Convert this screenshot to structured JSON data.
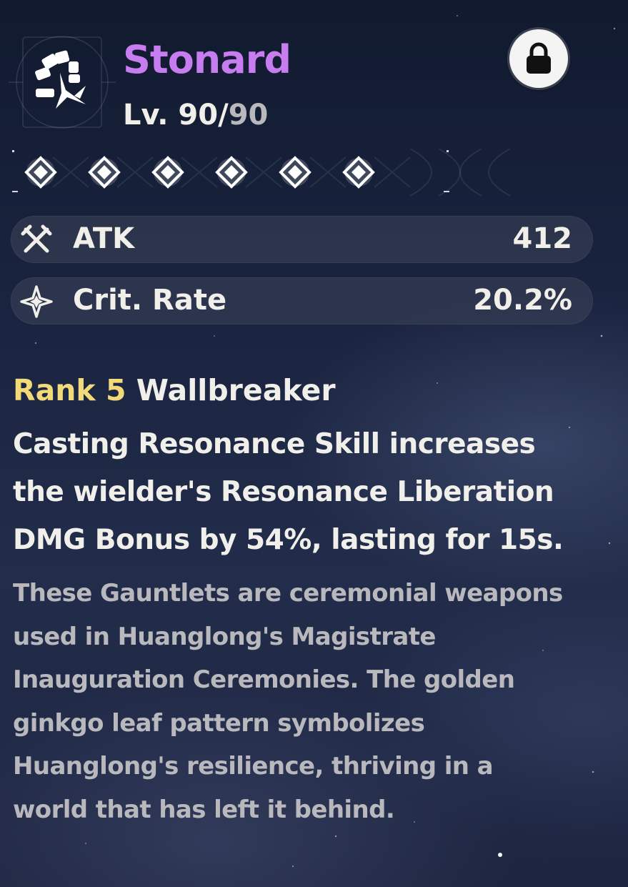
{
  "weapon": {
    "name": "Stonard",
    "level_prefix": "Lv. 90/",
    "level_max": "90",
    "icon": "gauntlet-fist-icon",
    "locked": true,
    "lock_icon": "padlock-icon"
  },
  "rank": {
    "total": 6,
    "filled": 6,
    "icon": "diamond-icon"
  },
  "stats": [
    {
      "icon": "crossed-swords-icon",
      "label": "ATK",
      "value": "412"
    },
    {
      "icon": "four-point-star-icon",
      "label": "Crit. Rate",
      "value": "20.2%"
    }
  ],
  "passive": {
    "rank_label": "Rank 5",
    "name": "Wallbreaker",
    "lines": [
      "Casting Resonance Skill increases",
      "the wielder's Resonance Liberation",
      "DMG Bonus by 54%, lasting for 15s."
    ]
  },
  "lore": {
    "lines": [
      "These Gauntlets are ceremonial weapons",
      "used in Huanglong's Magistrate",
      "Inauguration Ceremonies. The golden",
      "ginkgo leaf pattern symbolizes",
      "Huanglong's resilience, thriving in a",
      "world that has left it behind."
    ]
  },
  "colors": {
    "name": "#c77cf0",
    "rank": "#f3da79",
    "text": "#f1efe9",
    "muted": "#b9b9bd"
  }
}
